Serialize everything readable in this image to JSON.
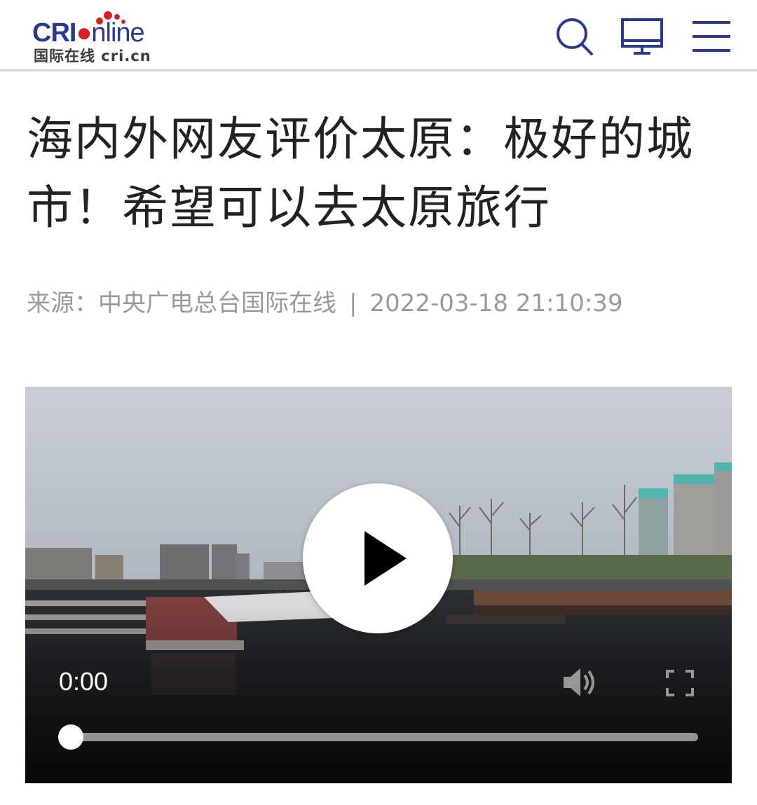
{
  "header": {
    "logo_main": "CRI",
    "logo_online": "nline",
    "logo_sub": "国际在线 cri.cn"
  },
  "article": {
    "title_line1": "海内外网友评价太原：极好的城",
    "title_line2": "市！希望可以去太原旅行",
    "source_label": "来源：",
    "source": "中央广电总台国际在线",
    "separator": "|",
    "datetime": "2022-03-18 21:10:39"
  },
  "video": {
    "current_time": "0:00",
    "progress": 0
  },
  "colors": {
    "brand_blue": "#2a3b8f",
    "brand_red": "#d71f2a",
    "title_text": "#222222",
    "meta_text": "#9a9a9a"
  }
}
